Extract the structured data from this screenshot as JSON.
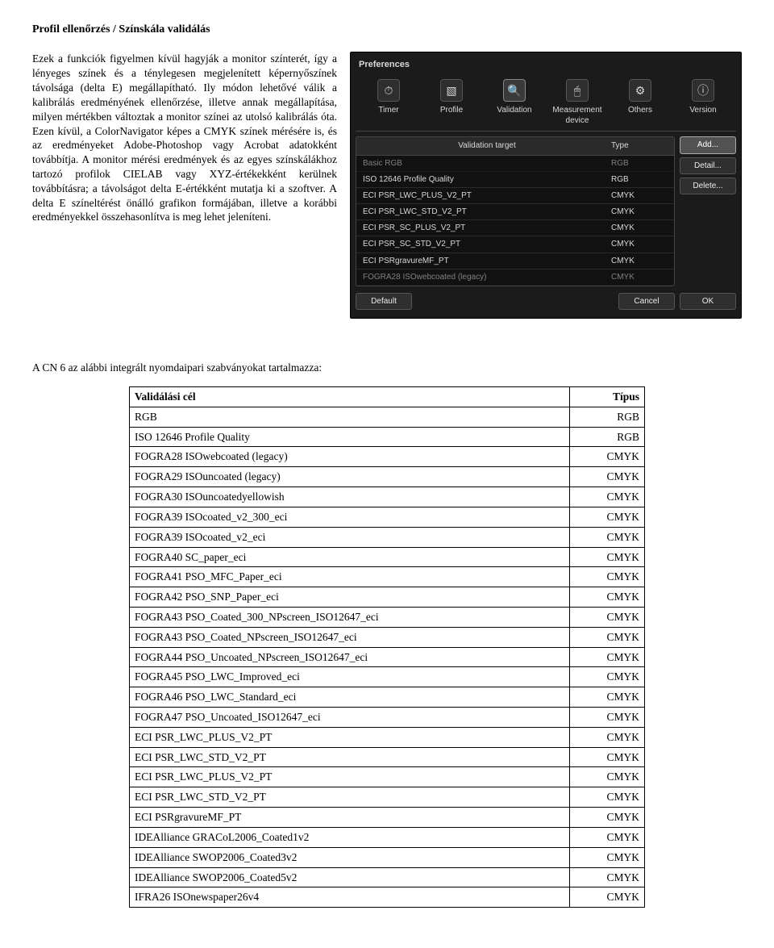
{
  "doc": {
    "heading": "Profil ellenőrzés / Színskála validálás",
    "body_text": "Ezek a funkciók figyelmen kívül hagyják a monitor színterét, így a lényeges színek és a ténylegesen megjelenített képernyőszínek távolsága (delta E) megállapítható. Ily módon lehetővé válik a kalibrálás eredményének ellenőrzése, illetve annak megállapítása, milyen mértékben változtak a monitor színei az utolsó kalibrálás óta. Ezen kívül, a ColorNavigator képes a CMYK színek mérésére is, és az eredményeket Adobe-Photoshop vagy Acrobat adatokként továbbítja. A monitor mérési eredmények és az egyes színskálákhoz tartozó profilok CIELAB vagy XYZ-értékekként kerülnek továbbításra; a távolságot delta E-értékként mutatja ki a szoftver. A delta E színeltérést önálló grafikon formájában, illetve a korábbi eredményekkel összehasonlítva is meg lehet jeleníteni.",
    "standards_intro": "A CN 6 az alábbi integrált nyomdaipari szabványokat tartalmazza:"
  },
  "prefs": {
    "title": "Preferences",
    "tabs": {
      "timer": "Timer",
      "profile": "Profile",
      "validation": "Validation",
      "measurement": "Measurement device",
      "others": "Others",
      "version": "Version"
    },
    "list_headers": {
      "target": "Validation target",
      "type": "Type"
    },
    "rows": [
      {
        "name": "Basic RGB",
        "type": "RGB"
      },
      {
        "name": "ISO 12646 Profile Quality",
        "type": "RGB"
      },
      {
        "name": "ECI PSR_LWC_PLUS_V2_PT",
        "type": "CMYK"
      },
      {
        "name": "ECI PSR_LWC_STD_V2_PT",
        "type": "CMYK"
      },
      {
        "name": "ECI PSR_SC_PLUS_V2_PT",
        "type": "CMYK"
      },
      {
        "name": "ECI PSR_SC_STD_V2_PT",
        "type": "CMYK"
      },
      {
        "name": "ECI PSRgravureMF_PT",
        "type": "CMYK"
      },
      {
        "name": "FOGRA28 ISOwebcoated (legacy)",
        "type": "CMYK"
      }
    ],
    "buttons": {
      "add": "Add...",
      "detail": "Detail...",
      "delete": "Delete..."
    },
    "footer": {
      "default": "Default",
      "cancel": "Cancel",
      "ok": "OK"
    },
    "icons": {
      "timer": "⏱",
      "profile": "▧",
      "validation": "🔍",
      "measurement": "🖱",
      "others": "⚙",
      "version": "ⓘ"
    }
  },
  "standards": {
    "header_target": "Validálási cél",
    "header_type": "Típus",
    "rows": [
      {
        "name": "RGB",
        "type": "RGB"
      },
      {
        "name": "ISO 12646 Profile Quality",
        "type": "RGB"
      },
      {
        "name": "FOGRA28 ISOwebcoated (legacy)",
        "type": "CMYK"
      },
      {
        "name": "FOGRA29 ISOuncoated (legacy)",
        "type": "CMYK"
      },
      {
        "name": "FOGRA30 ISOuncoatedyellowish",
        "type": "CMYK"
      },
      {
        "name": "FOGRA39 ISOcoated_v2_300_eci",
        "type": "CMYK"
      },
      {
        "name": "FOGRA39 ISOcoated_v2_eci",
        "type": "CMYK"
      },
      {
        "name": "FOGRA40 SC_paper_eci",
        "type": "CMYK"
      },
      {
        "name": "FOGRA41 PSO_MFC_Paper_eci",
        "type": "CMYK"
      },
      {
        "name": "FOGRA42 PSO_SNP_Paper_eci",
        "type": "CMYK"
      },
      {
        "name": "FOGRA43 PSO_Coated_300_NPscreen_ISO12647_eci",
        "type": "CMYK"
      },
      {
        "name": "FOGRA43 PSO_Coated_NPscreen_ISO12647_eci",
        "type": "CMYK"
      },
      {
        "name": "FOGRA44 PSO_Uncoated_NPscreen_ISO12647_eci",
        "type": "CMYK"
      },
      {
        "name": "FOGRA45 PSO_LWC_Improved_eci",
        "type": "CMYK"
      },
      {
        "name": "FOGRA46 PSO_LWC_Standard_eci",
        "type": "CMYK"
      },
      {
        "name": "FOGRA47 PSO_Uncoated_ISO12647_eci",
        "type": "CMYK"
      },
      {
        "name": "ECI PSR_LWC_PLUS_V2_PT",
        "type": "CMYK"
      },
      {
        "name": "ECI PSR_LWC_STD_V2_PT",
        "type": "CMYK"
      },
      {
        "name": "ECI PSR_LWC_PLUS_V2_PT",
        "type": "CMYK"
      },
      {
        "name": "ECI PSR_LWC_STD_V2_PT",
        "type": "CMYK"
      },
      {
        "name": "ECI PSRgravureMF_PT",
        "type": "CMYK"
      },
      {
        "name": "IDEAlliance GRACoL2006_Coated1v2",
        "type": "CMYK"
      },
      {
        "name": "IDEAlliance SWOP2006_Coated3v2",
        "type": "CMYK"
      },
      {
        "name": "IDEAlliance SWOP2006_Coated5v2",
        "type": "CMYK"
      },
      {
        "name": "IFRA26 ISOnewspaper26v4",
        "type": "CMYK"
      }
    ]
  }
}
